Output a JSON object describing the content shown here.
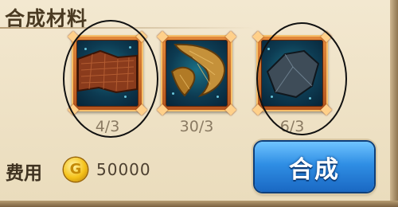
{
  "panel": {
    "title": "合成材料"
  },
  "materials": [
    {
      "name": "brown-hide-material",
      "count": "4/3"
    },
    {
      "name": "fur-tail-material",
      "count": "30/3"
    },
    {
      "name": "dark-stone-material",
      "count": "6/3"
    }
  ],
  "cost": {
    "label": "费用",
    "coin_letter": "G",
    "value": "50000"
  },
  "actions": {
    "synthesize_label": "合成"
  },
  "colors": {
    "button": "#2f8ee4",
    "slot_frame": "#e38a3c",
    "annotation": "#111111"
  }
}
